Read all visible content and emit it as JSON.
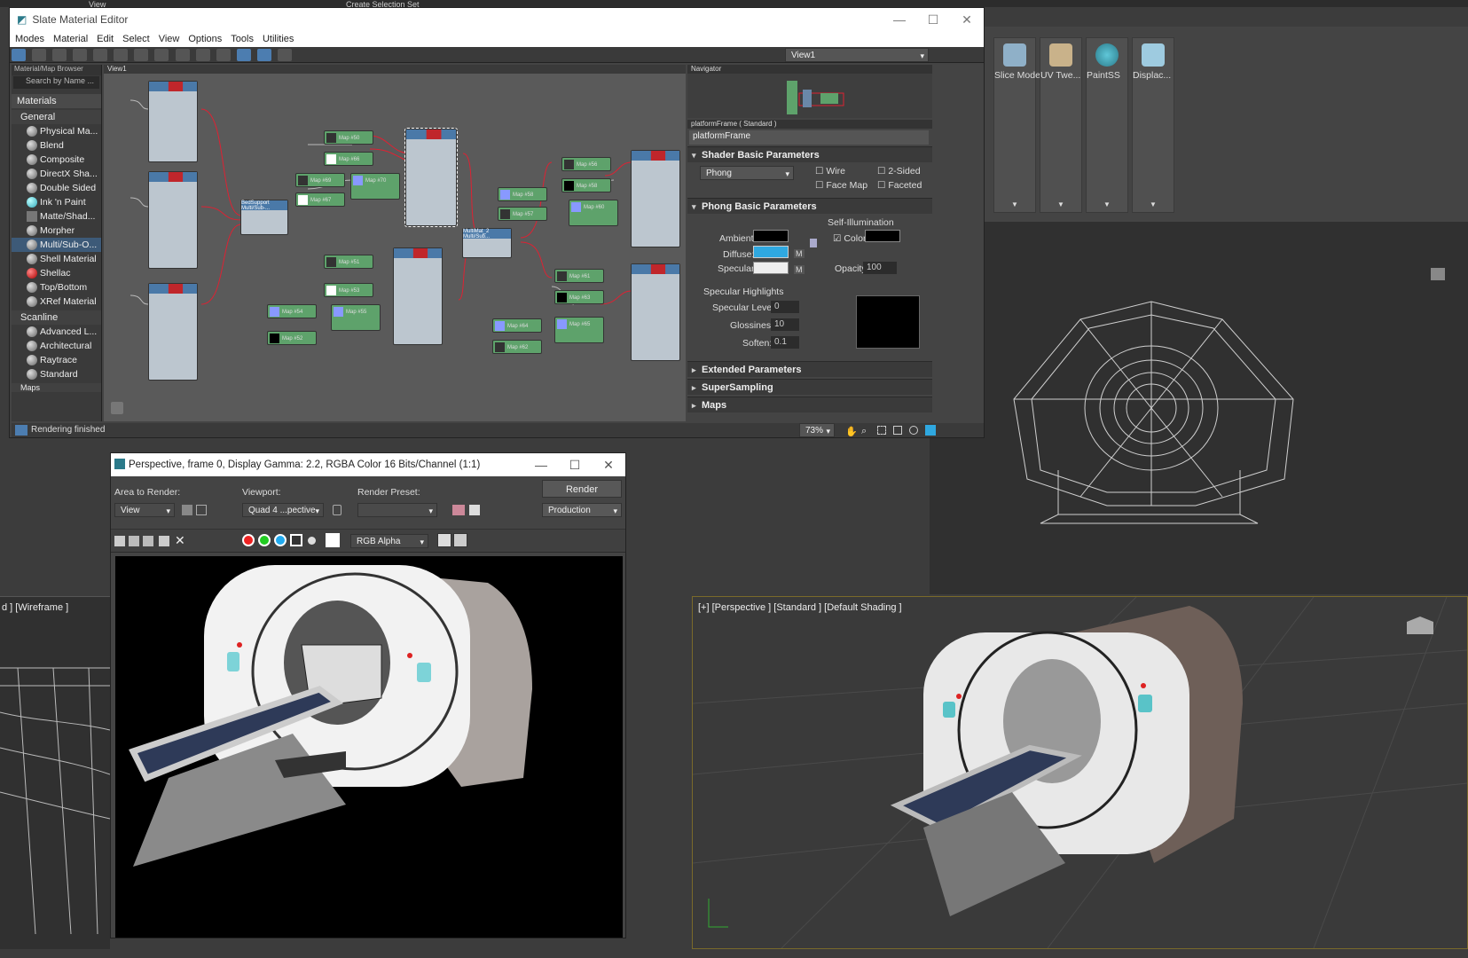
{
  "top_toolbar": {
    "view_label": "View",
    "selection_set": "Create Selection Set"
  },
  "right_toolbar": {
    "tiles": [
      {
        "label": "Slice Mode",
        "icon": "slice-mode-icon"
      },
      {
        "label": "UV Twe...",
        "icon": "uv-tweak-icon"
      },
      {
        "label": "PaintSS",
        "icon": "paint-ss-icon"
      },
      {
        "label": "Displac...",
        "icon": "displace-icon"
      }
    ]
  },
  "slate": {
    "title": "Slate Material Editor",
    "menu": [
      "Modes",
      "Material",
      "Edit",
      "Select",
      "View",
      "Options",
      "Tools",
      "Utilities"
    ],
    "view_dropdown": "View1",
    "browser": {
      "header": "Material/Map Browser",
      "search_placeholder": "Search by Name ...",
      "section_materials": "Materials",
      "sub_general": "General",
      "general_items": [
        "Physical Ma...",
        "Blend",
        "Composite",
        "DirectX Sha...",
        "Double Sided",
        "Ink 'n Paint",
        "Matte/Shad...",
        "Morpher",
        "Multi/Sub-O...",
        "Shell Material",
        "Shellac",
        "Top/Bottom",
        "XRef Material"
      ],
      "sub_scanline": "Scanline",
      "scanline_items": [
        "Advanced L...",
        "Architectural",
        "Raytrace",
        "Standard"
      ],
      "section_maps": "Maps"
    },
    "view_tab": "View1",
    "nodes": {
      "map_labels": [
        "Map #50",
        "Map #66",
        "Map #69",
        "Map #67",
        "Map #70",
        "Map #58",
        "Map #57",
        "Map #56",
        "Map #58",
        "Map #60",
        "Map #51",
        "Map #53",
        "Map #54",
        "Map #55",
        "Map #52",
        "Map #61",
        "Map #63",
        "Map #64",
        "Map #65",
        "Map #62"
      ],
      "multi_labels": [
        "BedSupport Multi/Sub-...",
        "MultiMat_2 Multi/Sub..."
      ]
    },
    "navigator": {
      "title": "Navigator"
    },
    "props": {
      "header": "platformFrame ( Standard )",
      "name_value": "platformFrame",
      "shader_title": "Shader Basic Parameters",
      "shader_value": "Phong",
      "wire": "Wire",
      "two_sided": "2-Sided",
      "face_map": "Face Map",
      "faceted": "Faceted",
      "phong_title": "Phong Basic Parameters",
      "self_illum": "Self-Illumination",
      "color_label": "Color",
      "ambient": "Ambient:",
      "diffuse": "Diffuse:",
      "specular": "Specular:",
      "m": "M",
      "opacity": "Opacity:",
      "opacity_val": "100",
      "spec_highlights": "Specular Highlights",
      "spec_level": "Specular Level:",
      "spec_level_val": "0",
      "glossiness": "Glossiness:",
      "glossiness_val": "10",
      "soften": "Soften:",
      "soften_val": "0.1",
      "extended": "Extended Parameters",
      "supersampling": "SuperSampling",
      "maps": "Maps"
    },
    "status": "Rendering finished",
    "zoom": "73%",
    "colors": {
      "diffuse": "#2fa8e0",
      "ambient": "#000000",
      "specular": "#eeeeee"
    }
  },
  "render": {
    "title": "Perspective, frame 0, Display Gamma: 2.2, RGBA Color 16 Bits/Channel (1:1)",
    "area_label": "Area to Render:",
    "area_value": "View",
    "viewport_label": "Viewport:",
    "viewport_value": "Quad 4 ...pective",
    "preset_label": "Render Preset:",
    "preset_value": "",
    "render_btn": "Render",
    "production": "Production",
    "channel": "RGB Alpha"
  },
  "viewports": {
    "left_label": "d ] [Wireframe ]",
    "right_label": "[+] [Perspective ] [Standard ] [Default Shading ]"
  }
}
